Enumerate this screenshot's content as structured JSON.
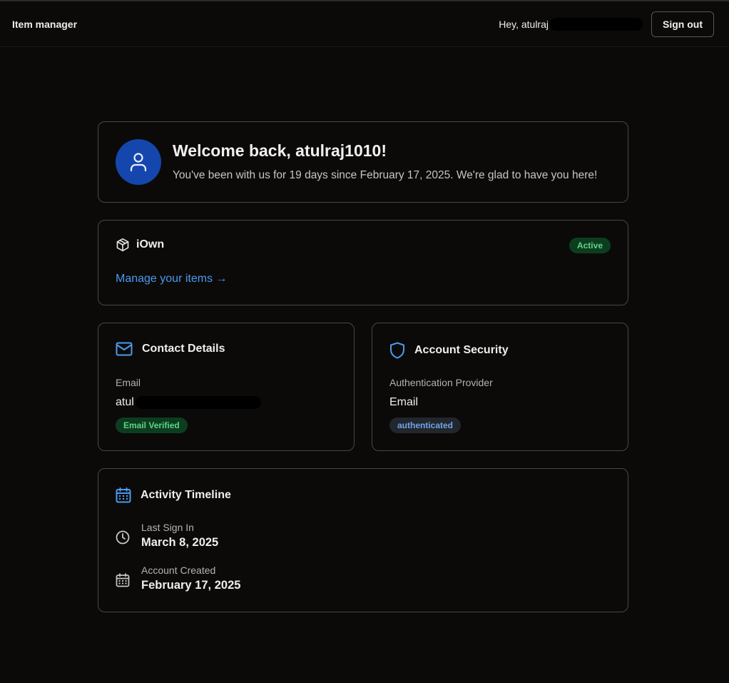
{
  "header": {
    "brand": "Item manager",
    "greeting": "Hey, atulraj",
    "sign_out_label": "Sign out"
  },
  "welcome": {
    "title": "Welcome back, atulraj1010!",
    "subtitle": "You've been with us for 19 days since February 17, 2025. We're glad to have you here!",
    "avatar_icon": "user-icon",
    "avatar_color": "#1546ad"
  },
  "app_card": {
    "title": "iOwn",
    "icon": "package-icon",
    "status": "Active",
    "link_label": "Manage your items →"
  },
  "contact": {
    "title": "Contact Details",
    "icon": "mail-icon",
    "email_label": "Email",
    "email_value": "atul",
    "badge": "Email Verified"
  },
  "security": {
    "title": "Account Security",
    "icon": "shield-icon",
    "provider_label": "Authentication Provider",
    "provider_value": "Email",
    "badge": "authenticated"
  },
  "timeline": {
    "title": "Activity Timeline",
    "icon": "calendar-icon",
    "items": [
      {
        "icon": "clock-icon",
        "label": "Last Sign In",
        "value": "March 8, 2025"
      },
      {
        "icon": "calendar-icon",
        "label": "Account Created",
        "value": "February 17, 2025"
      }
    ]
  },
  "colors": {
    "background": "#0b0a09",
    "accent_blue": "#4b9af0",
    "success_green": "#5fd488"
  }
}
